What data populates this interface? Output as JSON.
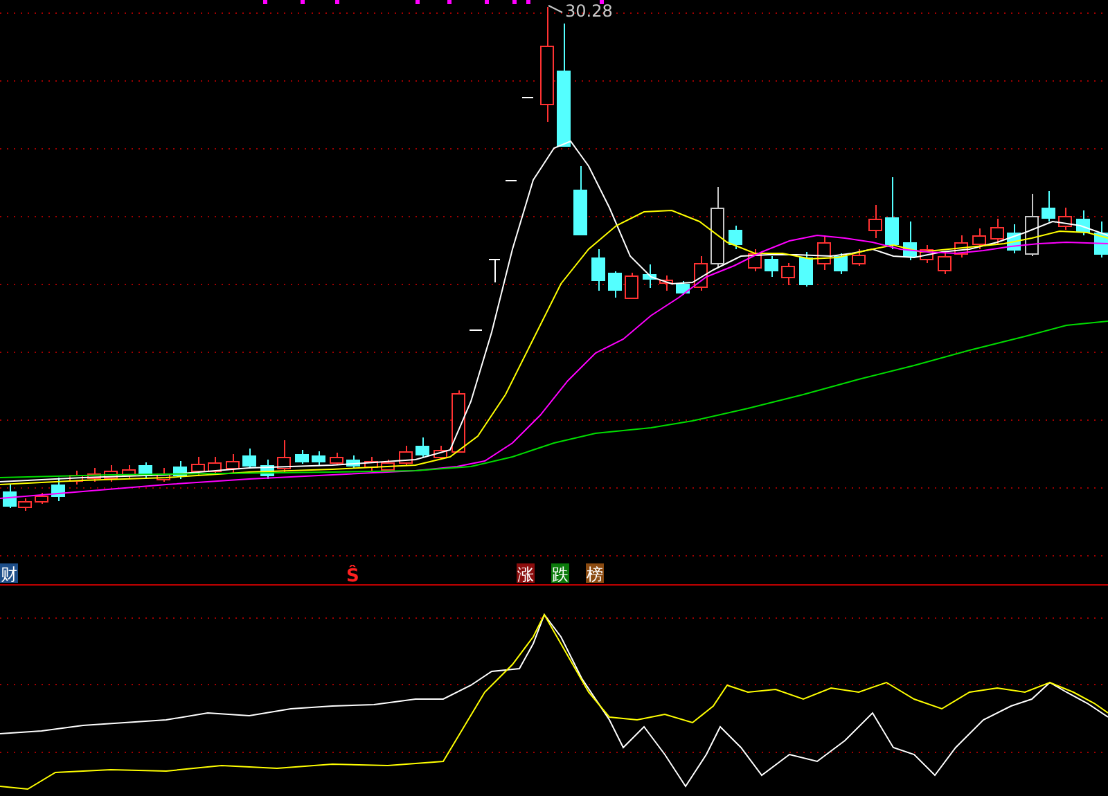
{
  "price_chart": {
    "high_label": "30.28"
  },
  "event_markers": [
    {
      "label": "财",
      "kind": "tag",
      "color": "#1d4e89"
    },
    {
      "label": "Ŝ",
      "kind": "text",
      "color": "#ff2020"
    },
    {
      "label": "涨",
      "kind": "tag",
      "color": "#8b0d0d"
    },
    {
      "label": "跌",
      "kind": "tag",
      "color": "#0b7a0b"
    },
    {
      "label": "榜",
      "kind": "tag",
      "color": "#8a4a10"
    }
  ]
}
